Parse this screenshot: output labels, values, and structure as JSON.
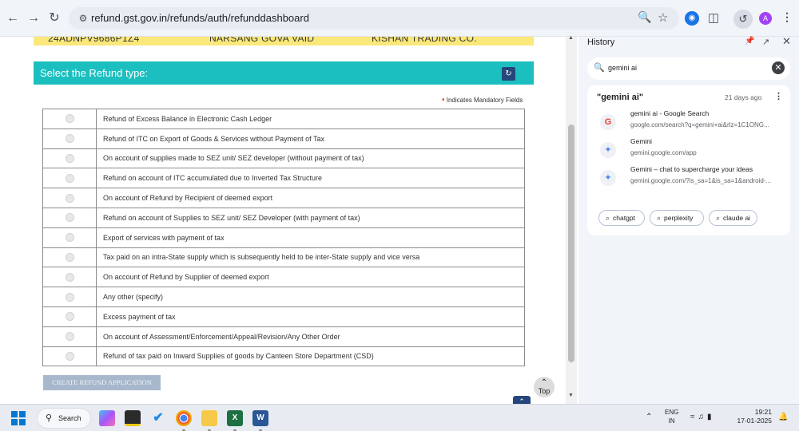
{
  "browser": {
    "url": "refund.gst.gov.in/refunds/auth/refunddashboard",
    "avatar_letter": "A"
  },
  "info_strip": {
    "gstin": "24ADNPV9686P1Z4",
    "legal_name": "NARSANG GOVA VAID",
    "trade_name": "KISHAN TRADING CO."
  },
  "refund": {
    "header": "Select the Refund type:",
    "mandatory_note": "Indicates Mandatory Fields",
    "options": [
      "Refund of Excess Balance in Electronic Cash Ledger",
      "Refund of ITC on Export of Goods & Services without Payment of Tax",
      "On account of supplies made to SEZ unit/ SEZ developer (without payment of tax)",
      "Refund on account of ITC accumulated due to Inverted Tax Structure",
      "On account of Refund by Recipient of deemed export",
      "Refund on account of Supplies to SEZ unit/ SEZ Developer (with payment of tax)",
      "Export of services with payment of tax",
      "Tax paid on an intra-State supply which is subsequently held to be inter-State supply and vice versa",
      "On account of Refund by Supplier of deemed export",
      "Any other (specify)",
      "Excess payment of tax",
      "On account of Assessment/Enforcement/Appeal/Revision/Any Other Order",
      "Refund of tax paid on Inward Supplies of goods by Canteen Store Department (CSD)"
    ],
    "create_button": "CREATE REFUND APPLICATION",
    "top_button": "Top"
  },
  "history_panel": {
    "title": "History",
    "search_query": "gemini ai",
    "group_title": "\"gemini ai\"",
    "group_time": "21 days ago",
    "entries": [
      {
        "title": "gemini ai - Google Search",
        "url": "google.com/search?q=gemini+ai&rlz=1C1ONG...",
        "icon": "google-icon"
      },
      {
        "title": "Gemini",
        "url": "gemini.google.com/app",
        "icon": "gemini-icon"
      },
      {
        "title": "Gemini – chat to supercharge your ideas",
        "url": "gemini.google.com/?is_sa=1&is_sa=1&android-...",
        "icon": "gemini-icon"
      }
    ],
    "related": [
      "chatgpt",
      "perplexity",
      "claude ai"
    ]
  },
  "taskbar": {
    "search_label": "Search",
    "lang_line1": "ENG",
    "lang_line2": "IN",
    "time": "19:21",
    "date": "17-01-2025"
  },
  "colors": {
    "header_teal": "#1cbfbf",
    "info_yellow": "#fbe87a",
    "button_disabled": "#a8b8cc",
    "navy": "#25467c"
  }
}
